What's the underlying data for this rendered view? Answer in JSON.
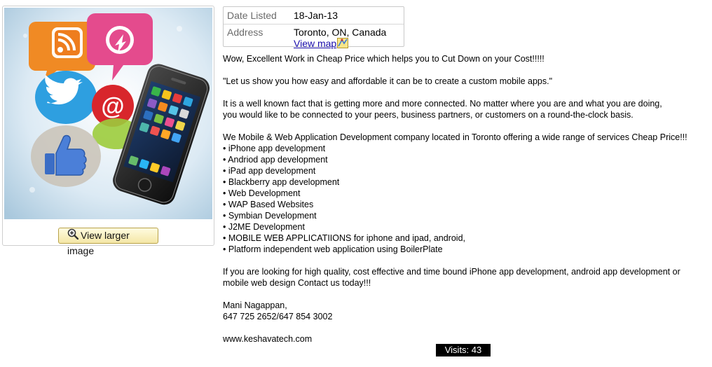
{
  "gallery": {
    "larger_image_label": "View larger image",
    "colors": {
      "bg_light": "#e9f2f8",
      "bg_mid": "#b7d4e6",
      "rss": "#f08a24",
      "twitter": "#2e9fe0",
      "email": "#d8262c",
      "like": "#3b6dc5",
      "bubble_pink": "#e44b8d",
      "bubble_green": "#9ccc3c"
    }
  },
  "details": {
    "date_label": "Date Listed",
    "date_value": "18-Jan-13",
    "address_label": "Address",
    "address_value": "Toronto, ON, Canada",
    "map_link": "View map"
  },
  "description": {
    "headline": "Wow, Excellent Work in Cheap Price which helps you to Cut Down on your Cost!!!!!",
    "quote": "\"Let us show you how easy and affordable it can be to create a custom mobile apps.\"",
    "para1_line1": "It is a well known fact that is getting more and more connected. No matter where you are and what you are doing,",
    "para1_line2": "you would like to be connected to your peers, business partners, or customers on a round-the-clock basis.",
    "intro": "We Mobile & Web Application Development company located in Toronto offering a wide range of services Cheap Price!!!",
    "services": [
      "iPhone app development",
      "Andriod app development",
      "iPad app development",
      "Blackberry app development",
      "Web Development",
      "WAP Based Websites",
      "Symbian Development",
      "J2ME Development",
      "MOBILE WEB APPLICATIIONS for iphone and ipad, android,",
      "Platform independent web application using BoilerPlate"
    ],
    "closing_line1": "If you are looking for high quality, cost effective and time bound iPhone app development, android app development or",
    "closing_line2": "mobile web design Contact us today!!!",
    "contact_name": "Mani Nagappan,",
    "contact_phone": "647 725 2652/647 854 3002",
    "website": "www.keshavatech.com"
  },
  "visits_label": "Visits: 43"
}
